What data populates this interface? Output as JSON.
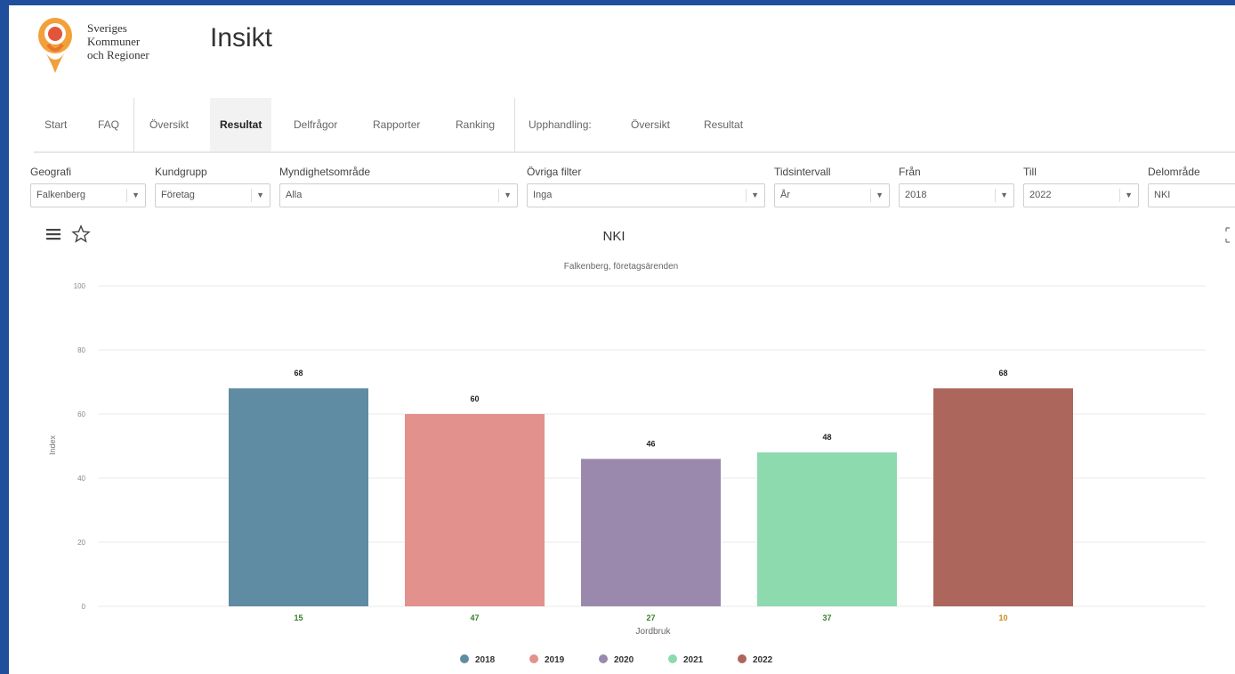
{
  "header": {
    "org_line1": "Sveriges",
    "org_line2": "Kommuner",
    "org_line3": "och Regioner",
    "app_title": "Insikt"
  },
  "nav": {
    "start": "Start",
    "faq": "FAQ",
    "oversikt": "Översikt",
    "resultat": "Resultat",
    "delfragor": "Delfrågor",
    "rapporter": "Rapporter",
    "ranking": "Ranking",
    "upphandling": "Upphandling:",
    "upphandling_oversikt": "Översikt",
    "upphandling_resultat": "Resultat"
  },
  "filters": {
    "geografi": {
      "label": "Geografi",
      "value": "Falkenberg"
    },
    "kundgrupp": {
      "label": "Kundgrupp",
      "value": "Företag"
    },
    "myndighetsomrade": {
      "label": "Myndighetsområde",
      "value": "Alla"
    },
    "ovriga": {
      "label": "Övriga filter",
      "value": "Inga"
    },
    "tidsintervall": {
      "label": "Tidsintervall",
      "value": "År"
    },
    "fran": {
      "label": "Från",
      "value": "2018"
    },
    "till": {
      "label": "Till",
      "value": "2022"
    },
    "delomrade": {
      "label": "Delområde",
      "value": "NKI"
    }
  },
  "icons": {
    "menu": "menu-icon",
    "favorite": "star-icon",
    "expand": "expand-icon",
    "dropdown": "chevron-down-icon"
  },
  "chart_data": {
    "type": "bar",
    "title": "NKI",
    "subtitle": "Falkenberg, företagsärenden",
    "xlabel": "Jordbruk",
    "ylabel": "Index",
    "ylim": [
      0,
      100
    ],
    "yticks": [
      0,
      20,
      40,
      60,
      80,
      100
    ],
    "grid": true,
    "legend": "bottom",
    "series": [
      {
        "name": "2018",
        "value": 68,
        "n": "15",
        "color": "#5f8ba3",
        "n_color": "#3a7d2e"
      },
      {
        "name": "2019",
        "value": 60,
        "n": "47",
        "color": "#e3918c",
        "n_color": "#3a7d2e"
      },
      {
        "name": "2020",
        "value": 46,
        "n": "27",
        "color": "#9a89ad",
        "n_color": "#3a7d2e"
      },
      {
        "name": "2021",
        "value": 48,
        "n": "37",
        "color": "#8cdaae",
        "n_color": "#3a7d2e"
      },
      {
        "name": "2022",
        "value": 68,
        "n": "10",
        "color": "#ad665c",
        "n_color": "#c88a1e"
      }
    ]
  }
}
